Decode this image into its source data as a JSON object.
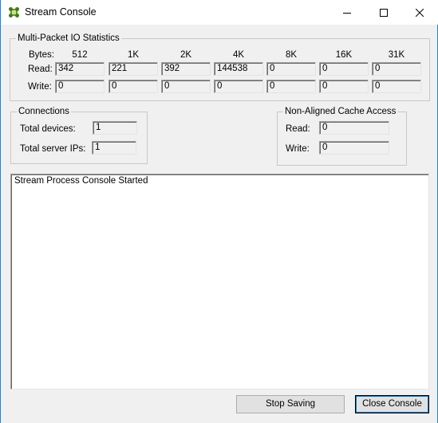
{
  "window": {
    "title": "Stream Console",
    "icon": "stream-app-icon",
    "accent": "#1883d7"
  },
  "stats": {
    "title": "Multi-Packet IO Statistics",
    "bytes_label": "Bytes:",
    "read_label": "Read:",
    "write_label": "Write:",
    "columns": [
      "512",
      "1K",
      "2K",
      "4K",
      "8K",
      "16K",
      "31K"
    ],
    "read": [
      "342",
      "221",
      "392",
      "144538",
      "0",
      "0",
      "0"
    ],
    "write": [
      "0",
      "0",
      "0",
      "0",
      "0",
      "0",
      "0"
    ]
  },
  "connections": {
    "title": "Connections",
    "devices_label": "Total devices:",
    "devices_value": "1",
    "ips_label": "Total server IPs:",
    "ips_value": "1"
  },
  "cache": {
    "title": "Non-Aligned Cache Access",
    "read_label": "Read:",
    "read_value": "0",
    "write_label": "Write:",
    "write_value": "0"
  },
  "console": {
    "text": "Stream Process Console Started"
  },
  "buttons": {
    "stop_saving": "Stop Saving",
    "close_console": "Close Console"
  }
}
